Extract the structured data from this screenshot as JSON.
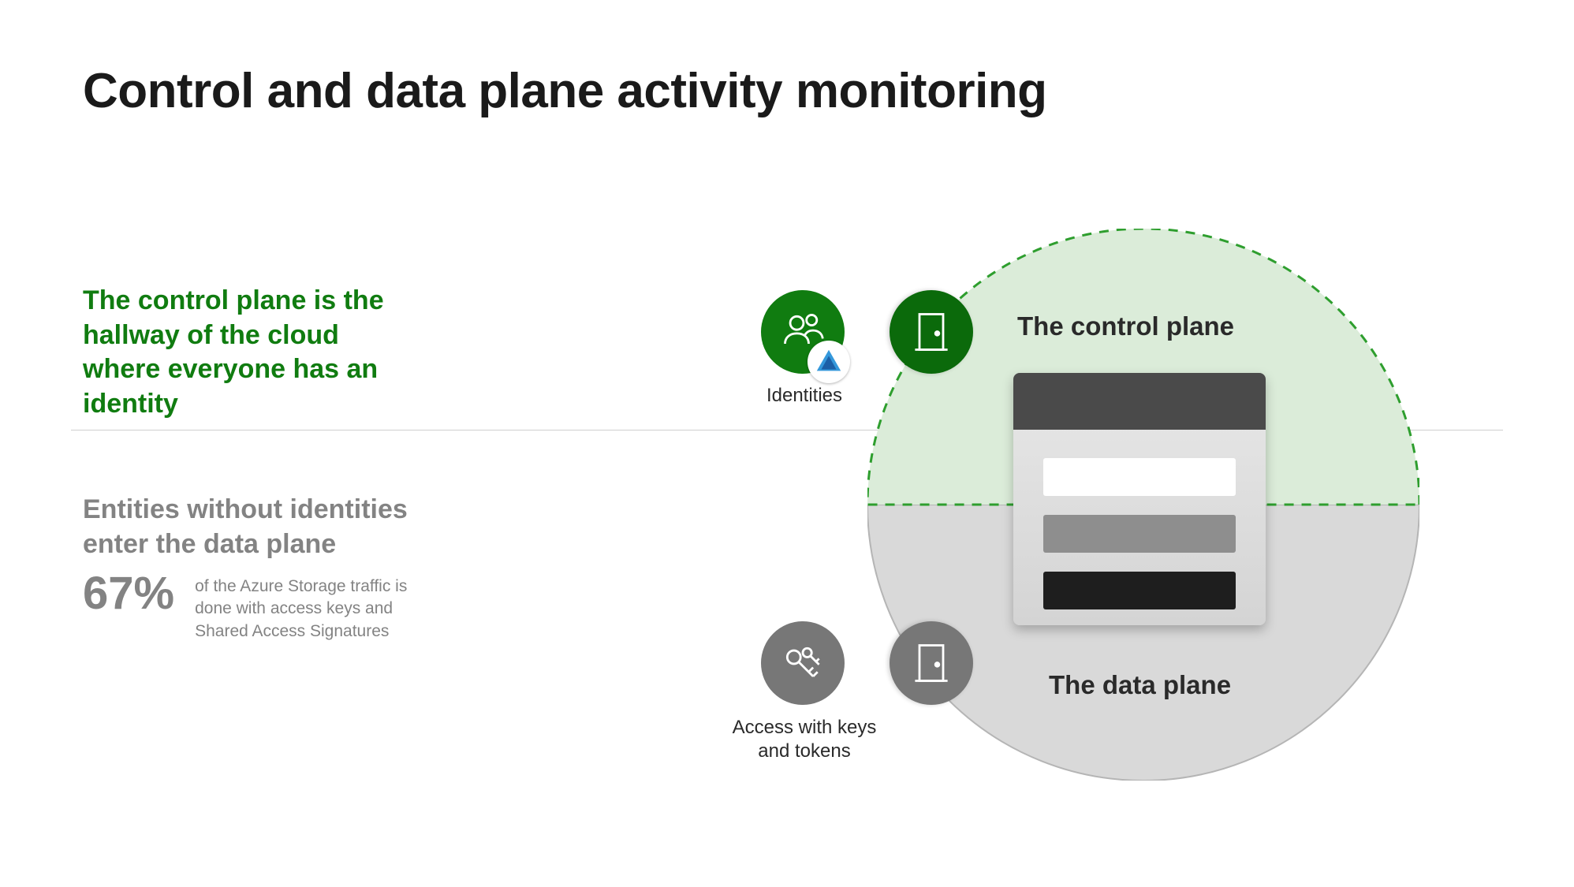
{
  "title": "Control and data plane activity monitoring",
  "upper": {
    "text": "The control plane is the hallway of the cloud where everyone has an identity"
  },
  "lower": {
    "text": "Entities without identities enter the data plane",
    "stat_pct": "67%",
    "stat_desc": "of the Azure Storage traffic is done with access keys and Shared Access Signatures"
  },
  "diagram": {
    "control_label": "The control plane",
    "data_label": "The data plane",
    "identities_caption": "Identities",
    "keys_caption": "Access with keys and tokens"
  }
}
